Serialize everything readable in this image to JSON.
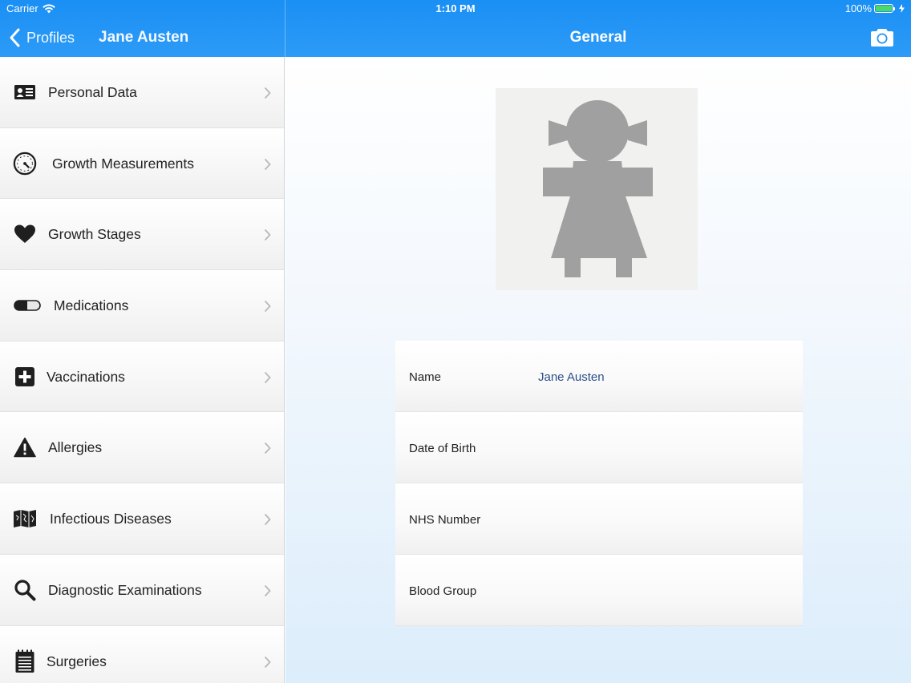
{
  "status_bar": {
    "carrier": "Carrier",
    "time": "1:10 PM",
    "battery": "100%"
  },
  "nav": {
    "back_label": "Profiles",
    "profile_name": "Jane Austen",
    "detail_title": "General"
  },
  "sidebar": {
    "items": [
      {
        "label": "Personal Data",
        "icon": "id-card-icon"
      },
      {
        "label": "Growth Measurements",
        "icon": "gauge-icon"
      },
      {
        "label": "Growth Stages",
        "icon": "heart-icon"
      },
      {
        "label": "Medications",
        "icon": "pill-icon"
      },
      {
        "label": "Vaccinations",
        "icon": "plus-square-icon"
      },
      {
        "label": "Allergies",
        "icon": "warning-icon"
      },
      {
        "label": "Infectious Diseases",
        "icon": "map-icon"
      },
      {
        "label": "Diagnostic Examinations",
        "icon": "search-icon"
      },
      {
        "label": "Surgeries",
        "icon": "notepad-icon"
      }
    ]
  },
  "general": {
    "fields": [
      {
        "label": "Name",
        "value": "Jane Austen"
      },
      {
        "label": "Date of Birth",
        "value": ""
      },
      {
        "label": "NHS Number",
        "value": ""
      },
      {
        "label": "Blood Group",
        "value": ""
      }
    ]
  },
  "colors": {
    "nav_bar": "#2196f3",
    "field_value": "#2d4f8a",
    "avatar_silhouette": "#a0a0a0"
  }
}
